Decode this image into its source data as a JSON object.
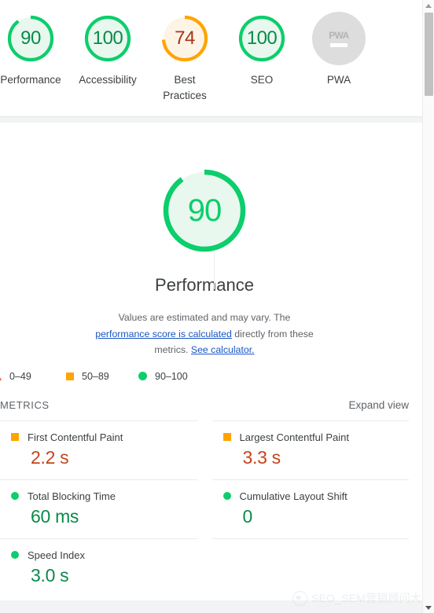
{
  "report": {
    "category_scores": [
      {
        "label": "Performance",
        "score": 90,
        "display": "90",
        "state": "good",
        "color": "#0cce6b",
        "track": "#e8f8ef"
      },
      {
        "label": "Accessibility",
        "score": 100,
        "display": "100",
        "state": "good",
        "color": "#0cce6b",
        "track": "#e8f8ef"
      },
      {
        "label": "Best Practices",
        "score": 74,
        "display": "74",
        "state": "average",
        "color": "#ffa400",
        "track": "#fdf4e6"
      },
      {
        "label": "SEO",
        "score": 100,
        "display": "100",
        "state": "good",
        "color": "#0cce6b",
        "track": "#e8f8ef"
      },
      {
        "label": "PWA",
        "score": null,
        "display": "PWA",
        "state": "null",
        "color": "#dddddd",
        "track": "#dddddd"
      }
    ],
    "primary": {
      "score": 90,
      "display": "90",
      "title": "Performance",
      "color": "#0cce6b",
      "track": "#e8f8ef"
    },
    "disclaimer": {
      "lead": "Values are estimated and may vary. The ",
      "link_text": "performance score is calculated",
      "middle": " directly from these metrics. ",
      "calculator_link": "See calculator."
    },
    "legend": [
      {
        "marker": "triangle-marker",
        "range": "0–49",
        "color": "#ff4e42"
      },
      {
        "marker": "square-marker",
        "range": "50–89",
        "color": "#ffa400"
      },
      {
        "marker": "circle-marker",
        "range": "90–100",
        "color": "#0cce6b"
      }
    ],
    "metrics_section": {
      "title": "METRICS",
      "expand_label": "Expand view",
      "items": [
        {
          "name": "First Contentful Paint",
          "value": "2.2 s",
          "state": "average"
        },
        {
          "name": "Largest Contentful Paint",
          "value": "3.3 s",
          "state": "average"
        },
        {
          "name": "Total Blocking Time",
          "value": "60 ms",
          "state": "good"
        },
        {
          "name": "Cumulative Layout Shift",
          "value": "0",
          "state": "good"
        },
        {
          "name": "Speed Index",
          "value": "3.0 s",
          "state": "good"
        }
      ]
    },
    "watermark": {
      "text": "SEO_SEM营销顾问大师",
      "logo": "weibo-logo"
    }
  }
}
